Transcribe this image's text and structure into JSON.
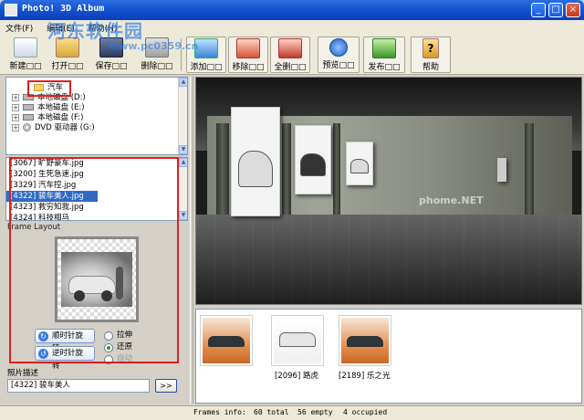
{
  "window": {
    "title": "Photo! 3D Album"
  },
  "menu": [
    "文件(F)",
    "编辑(E)",
    "帮助(H)"
  ],
  "watermark": {
    "brand": "河东软件园",
    "url": "www.pc0359.cn"
  },
  "toolbar": {
    "new": "新建□□",
    "open": "打开□□",
    "save": "保存□□",
    "delete": "删除□□",
    "add": "添加□□",
    "remove": "移除□□",
    "remove_all": "全删□□",
    "preview": "预览□□",
    "publish": "发布□□",
    "help": "帮助"
  },
  "tree": [
    {
      "label": "汽车",
      "type": "folder",
      "selected": true
    },
    {
      "label": "本地磁盘 (D:)",
      "type": "drive"
    },
    {
      "label": "本地磁盘 (E:)",
      "type": "drive"
    },
    {
      "label": "本地磁盘 (F:)",
      "type": "drive"
    },
    {
      "label": "DVD 驱动器 (G:)",
      "type": "cd"
    }
  ],
  "files": [
    {
      "label": "[3067] 旷野豪车.jpg"
    },
    {
      "label": "[3200] 生死急速.jpg"
    },
    {
      "label": "[3329] 汽车控.jpg"
    },
    {
      "label": "[4322] 骏车美人.jpg",
      "selected": true
    },
    {
      "label": "[4323] 救穷知我.jpg"
    },
    {
      "label": "[4324] 科技相马"
    }
  ],
  "frame_layout": {
    "label": "Frame Layout",
    "rotate_ccw": "顺时针旋转",
    "rotate_cw": "逆时针旋转",
    "opt_stretch": "拉伸",
    "opt_restore": "还原",
    "opt_auto": "自动"
  },
  "description": {
    "label": "照片描述",
    "value": "[4322] 骏车美人",
    "button": ">>"
  },
  "view3d": {
    "overlay": "phome.NET"
  },
  "strip": [
    {
      "caption": ""
    },
    {
      "caption": "[2096] 路虎"
    },
    {
      "caption": "[2189] 乐之光"
    }
  ],
  "status": {
    "frames_info": "Frames info:",
    "total": "60 total",
    "empty": "56 empty",
    "occupied": "4 occupied"
  },
  "colors": {
    "title_bar": "#1553d4",
    "highlight": "#316ac5",
    "annotation_red": "#e0201c"
  }
}
